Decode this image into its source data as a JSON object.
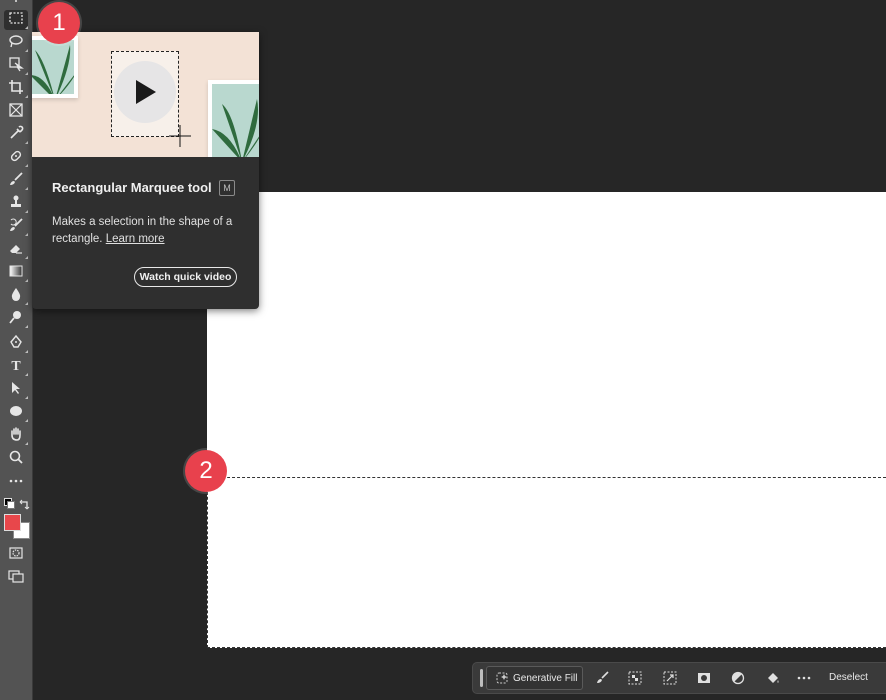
{
  "tooltip": {
    "title": "Rectangular Marquee tool",
    "shortcut": "M",
    "description": "Makes a selection in the shape of a rectangle.",
    "learn_more": "Learn more",
    "watch_video": "Watch quick video"
  },
  "callouts": [
    "1",
    "2"
  ],
  "taskbar": {
    "generative_fill": "Generative Fill",
    "deselect": "Deselect"
  },
  "colors": {
    "foreground": "#e8474b",
    "background": "#ffffff",
    "callout": "#e8414d"
  },
  "tools": [
    "move-icon",
    "rectangular-marquee-icon",
    "lasso-icon",
    "object-selection-icon",
    "crop-icon",
    "frame-icon",
    "eyedropper-icon",
    "spot-healing-icon",
    "brush-icon",
    "clone-stamp-icon",
    "history-brush-icon",
    "eraser-icon",
    "gradient-icon",
    "blur-icon",
    "dodge-icon",
    "pen-icon",
    "type-icon",
    "path-selection-icon",
    "ellipse-icon",
    "hand-icon",
    "zoom-icon",
    "more-tools-icon"
  ]
}
